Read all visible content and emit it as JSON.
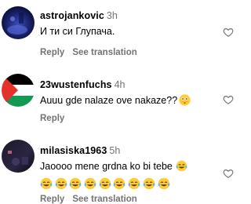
{
  "comments": [
    {
      "username": "astrojankovic",
      "time": "3h",
      "text": "И ти си Глупача.",
      "reply_label": "Reply",
      "translate_label": "See translation",
      "avatar_icon": "dark-blue-photo-avatar",
      "like_icon": "heart-outline-icon"
    },
    {
      "username": "23wustenfuchs",
      "time": "4h",
      "text": "Auuu gde nalaze ove nakaze??",
      "text_emoji": "flushed-face-emoji",
      "reply_label": "Reply",
      "avatar_icon": "palestine-flag-avatar",
      "like_icon": "heart-outline-icon"
    },
    {
      "username": "milasiska1963",
      "time": "5h",
      "text": "Jaoooo mene grdna ko bi tebe",
      "text_emoji": "tears-of-joy-emoji",
      "emoji_row": [
        "tears-of-joy-emoji",
        "tears-of-joy-emoji",
        "tears-of-joy-emoji",
        "tears-of-joy-emoji",
        "tears-of-joy-emoji",
        "tears-of-joy-emoji",
        "tears-of-joy-emoji",
        "tears-of-joy-emoji",
        "tears-of-joy-emoji"
      ],
      "reply_label": "Reply",
      "translate_label": "See translation",
      "avatar_icon": "dark-photo-avatar",
      "like_icon": "heart-outline-icon"
    }
  ],
  "colors": {
    "secondary_text": "#737373",
    "primary_text": "#000000",
    "background": "#ffffff"
  }
}
